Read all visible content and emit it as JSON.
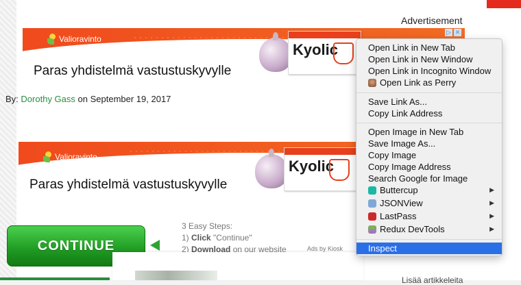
{
  "advertisement_label": "Advertisement",
  "ad_banner_1": {
    "brand": "Valioravinto",
    "headline": "Paras yhdistelmä vastustuskyvylle",
    "product": "Kyolic"
  },
  "ad_banner_2": {
    "brand": "Valioravinto",
    "headline": "Paras yhdistelmä vastustuskyvylle",
    "product": "Kyolic"
  },
  "byline": {
    "prefix": "By:",
    "author": "Dorothy Gass",
    "date_text": "on September 19, 2017"
  },
  "cta": {
    "button_label": "CONTINUE"
  },
  "steps": {
    "heading": "3 Easy Steps:",
    "step1_num": "1)",
    "step1_bold": "Click",
    "step1_rest": "\"Continue\"",
    "step2_num": "2)",
    "step2_bold": "Download",
    "step2_rest": "on our website"
  },
  "ads_by": "Ads by Kiosk",
  "footer_partial": "Lisää artikkeleita",
  "context_menu": {
    "group1": [
      "Open Link in New Tab",
      "Open Link in New Window",
      "Open Link in Incognito Window",
      "Open Link as Perry"
    ],
    "group2": [
      "Save Link As...",
      "Copy Link Address"
    ],
    "group3": [
      "Open Image in New Tab",
      "Save Image As...",
      "Copy Image",
      "Copy Image Address",
      "Search Google for Image"
    ],
    "extensions": [
      "Buttercup",
      "JSONView",
      "LastPass",
      "Redux DevTools"
    ],
    "inspect": "Inspect"
  },
  "colors": {
    "accent_red": "#e52b1d",
    "ad_orange": "#f04a1d",
    "cta_green": "#1f9a22",
    "menu_highlight": "#2b6fe7",
    "link_green": "#2a8e3e"
  }
}
